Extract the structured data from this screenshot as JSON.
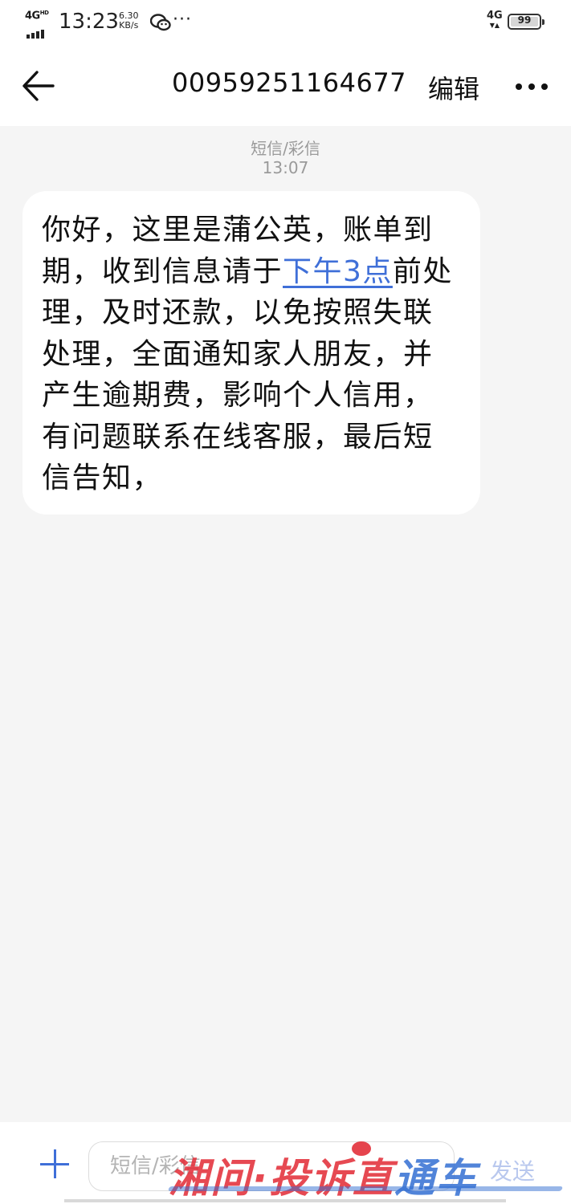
{
  "status_bar": {
    "network": "4G",
    "network_sup": "HD",
    "time": "13:23",
    "speed_value": "6.30",
    "speed_unit": "KB/s",
    "more": "···",
    "mobile_data": "4G",
    "battery": "99"
  },
  "header": {
    "title": "00959251164677",
    "edit_label": "编辑"
  },
  "conversation": {
    "message_type": "短信/彩信",
    "time": "13:07",
    "message": {
      "part1": "你好，这里是蒲公英，账单到期，收到信息请于",
      "link": "下午3点",
      "part2": "前处理，及时还款，以免按照失联处理，全面通知家人朋友，并产生逾期费，影响个人信用，有问题联系在线客服，最后短信告知，"
    }
  },
  "composer": {
    "placeholder": "短信/彩信",
    "send_label": "发送"
  },
  "watermark": {
    "text_red": "湘问·投诉直",
    "text_blue": "通车"
  },
  "colors": {
    "accent": "#3f6fd8",
    "background": "#f5f5f5",
    "bubble": "#ffffff",
    "meta_text": "#9a9a9a"
  }
}
